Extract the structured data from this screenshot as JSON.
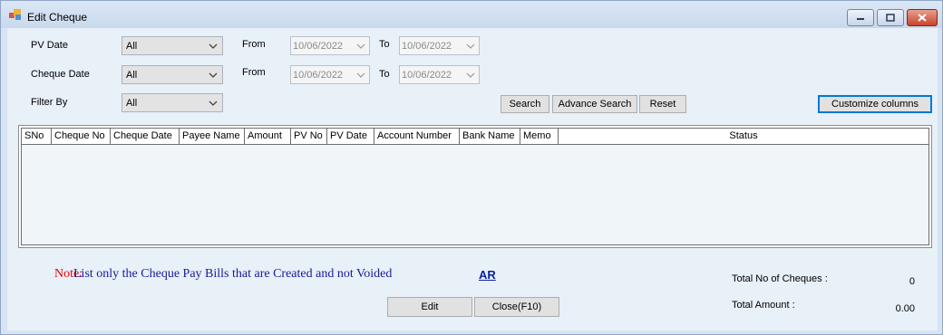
{
  "window": {
    "title": "Edit Cheque"
  },
  "filters": {
    "pv_date": {
      "label": "PV Date",
      "value": "All",
      "from_label": "From",
      "from_value": "10/06/2022",
      "to_label": "To",
      "to_value": "10/06/2022"
    },
    "cheque_date": {
      "label": "Cheque Date",
      "value": "All",
      "from_label": "From",
      "from_value": "10/06/2022",
      "to_label": "To",
      "to_value": "10/06/2022"
    },
    "filter_by": {
      "label": "Filter By",
      "value": "All"
    }
  },
  "buttons": {
    "search": "Search",
    "advance_search": "Advance Search",
    "reset": "Reset",
    "customize_columns": "Customize columns",
    "edit": "Edit",
    "close": "Close(F10)"
  },
  "grid": {
    "columns": [
      "SNo",
      "Cheque No",
      "Cheque Date",
      "Payee Name",
      "Amount",
      "PV No",
      "PV Date",
      "Account Number",
      "Bank Name",
      "Memo",
      "Status"
    ],
    "rows": []
  },
  "note": {
    "label": "Note:",
    "text": "List only the Cheque Pay Bills that are Created and not Voided",
    "link": "AR"
  },
  "summary": {
    "total_cheques_label": "Total No of Cheques :",
    "total_cheques_value": "0",
    "total_amount_label": "Total Amount :",
    "total_amount_value": "0.00"
  },
  "colors": {
    "note_label": "#e00000",
    "note_text": "#1a1a9a",
    "link": "#0a1f9a",
    "focus_border": "#0078d7"
  }
}
